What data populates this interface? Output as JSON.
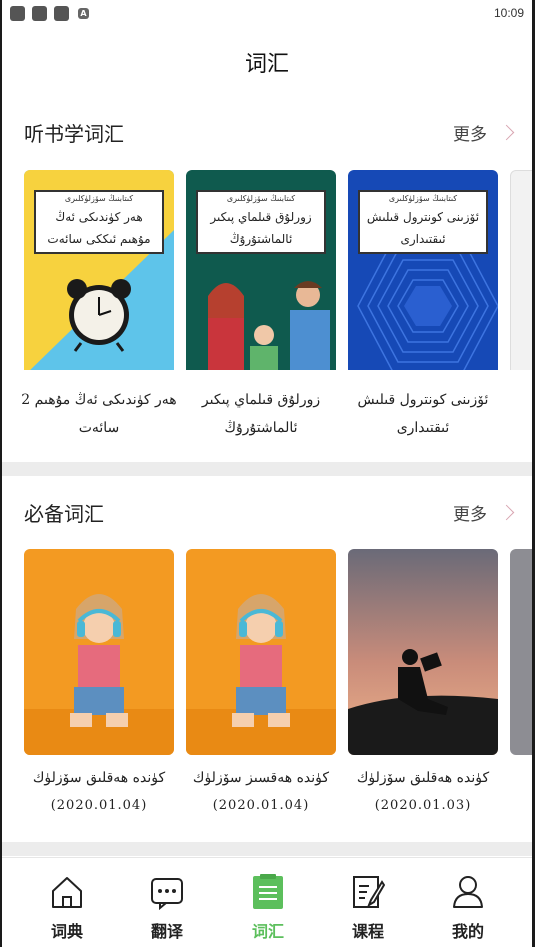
{
  "status_bar": {
    "time": "10:09",
    "badge": "A"
  },
  "page": {
    "title": "词汇"
  },
  "section_listen": {
    "title": "听书学词汇",
    "more": "更多",
    "cards": [
      {
        "cover_tag": "كىتابنىڭ سۆزلۈكلىرى",
        "cover_title": "ھەر كۈندىكى ئەڭ مۇھىم ئىككى سائەت",
        "label": "ھەر كۈندىكى ئەڭ مۇھىم 2 سائەت"
      },
      {
        "cover_tag": "كىتابنىڭ سۆزلۈكلىرى",
        "cover_title": "زورلۇق قىلماي پىكىر ئالماشتۇرۇڭ",
        "label": "زورلۇق قىلماي پىكىر ئالماشتۇرۇڭ"
      },
      {
        "cover_tag": "كىتابنىڭ سۆزلۈكلىرى",
        "cover_title": "ئۆزىنى كونترول قىلىش ئىقتىدارى",
        "label": "ئۆزىنى كونترول قىلىش ئىقتىدارى"
      }
    ]
  },
  "section_essential": {
    "title": "必备词汇",
    "more": "更多",
    "cards": [
      {
        "label": "كۈندە ھەقلىق سۆزلۈك",
        "date": "(2020.01.04)"
      },
      {
        "label": "كۈندە ھەقسىز سۆزلۈك",
        "date": "(2020.01.04)"
      },
      {
        "label": "كۈندە ھەقلىق سۆزلۈك",
        "date": "(2020.01.03)"
      }
    ]
  },
  "tabs": [
    {
      "label": "词典",
      "icon": "house-icon"
    },
    {
      "label": "翻译",
      "icon": "chat-bubble-icon"
    },
    {
      "label": "词汇",
      "icon": "document-icon",
      "active": true
    },
    {
      "label": "课程",
      "icon": "edit-note-icon"
    },
    {
      "label": "我的",
      "icon": "person-icon"
    }
  ],
  "colors": {
    "accent": "#5cbf5c",
    "divider": "#ececec"
  }
}
